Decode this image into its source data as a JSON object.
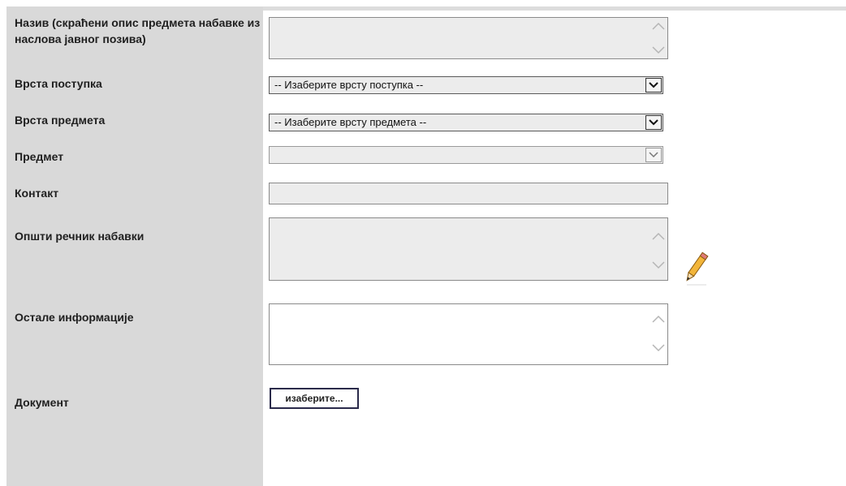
{
  "form": {
    "fields": [
      {
        "label": "Назив (скраћени опис предмета набавке из наслова јавног позива)"
      },
      {
        "label": "Врста поступка",
        "value": "-- Изаберите врсту поступка --"
      },
      {
        "label": "Врста предмета",
        "value": "-- Изаберите врсту предмета --"
      },
      {
        "label": "Предмет",
        "value": ""
      },
      {
        "label": "Контакт",
        "value": ""
      },
      {
        "label": "Општи речник набавки",
        "value": ""
      },
      {
        "label": "Остале информације",
        "value": ""
      },
      {
        "label": "Документ",
        "button_label": "изаберите..."
      }
    ]
  },
  "icons": {
    "textarea_scroll_up": "chevron-up-icon",
    "textarea_scroll_down": "chevron-down-icon",
    "select_dropdown": "chevron-down-icon",
    "edit": "pencil-icon"
  },
  "colors": {
    "label_column_bg": "#d9d9d9",
    "field_bg": "#ececec",
    "field_border": "#8a8a8a"
  }
}
